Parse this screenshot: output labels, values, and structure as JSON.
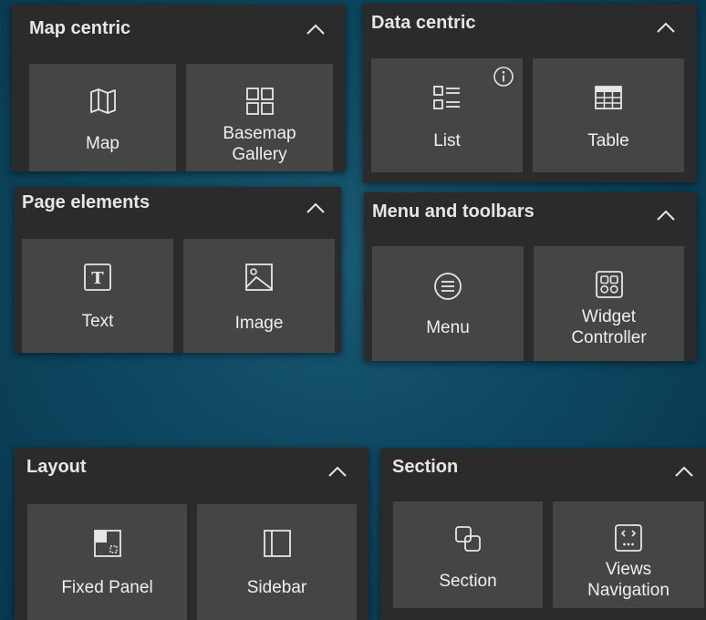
{
  "panels": {
    "map_centric": {
      "title": "Map centric",
      "tiles": [
        {
          "label": "Map",
          "icon": "map-icon"
        },
        {
          "label": "Basemap\nGallery",
          "icon": "basemap-gallery-icon"
        }
      ]
    },
    "data_centric": {
      "title": "Data centric",
      "tiles": [
        {
          "label": "List",
          "icon": "list-icon"
        },
        {
          "label": "Table",
          "icon": "table-icon"
        }
      ]
    },
    "page_elements": {
      "title": "Page elements",
      "tiles": [
        {
          "label": "Text",
          "icon": "text-icon"
        },
        {
          "label": "Image",
          "icon": "image-icon"
        }
      ]
    },
    "menu_toolbars": {
      "title": "Menu and toolbars",
      "tiles": [
        {
          "label": "Menu",
          "icon": "menu-icon"
        },
        {
          "label": "Widget\nController",
          "icon": "widget-controller-icon"
        }
      ]
    },
    "layout": {
      "title": "Layout",
      "tiles": [
        {
          "label": "Fixed Panel",
          "icon": "fixed-panel-icon"
        },
        {
          "label": "Sidebar",
          "icon": "sidebar-icon"
        }
      ]
    },
    "section": {
      "title": "Section",
      "tiles": [
        {
          "label": "Section",
          "icon": "section-icon"
        },
        {
          "label": "Views\nNavigation",
          "icon": "views-navigation-icon"
        }
      ]
    }
  },
  "colors": {
    "panel_bg": "#2b2b2b",
    "tile_bg": "#454545",
    "text": "#efefef",
    "backdrop": "#0d4760"
  }
}
